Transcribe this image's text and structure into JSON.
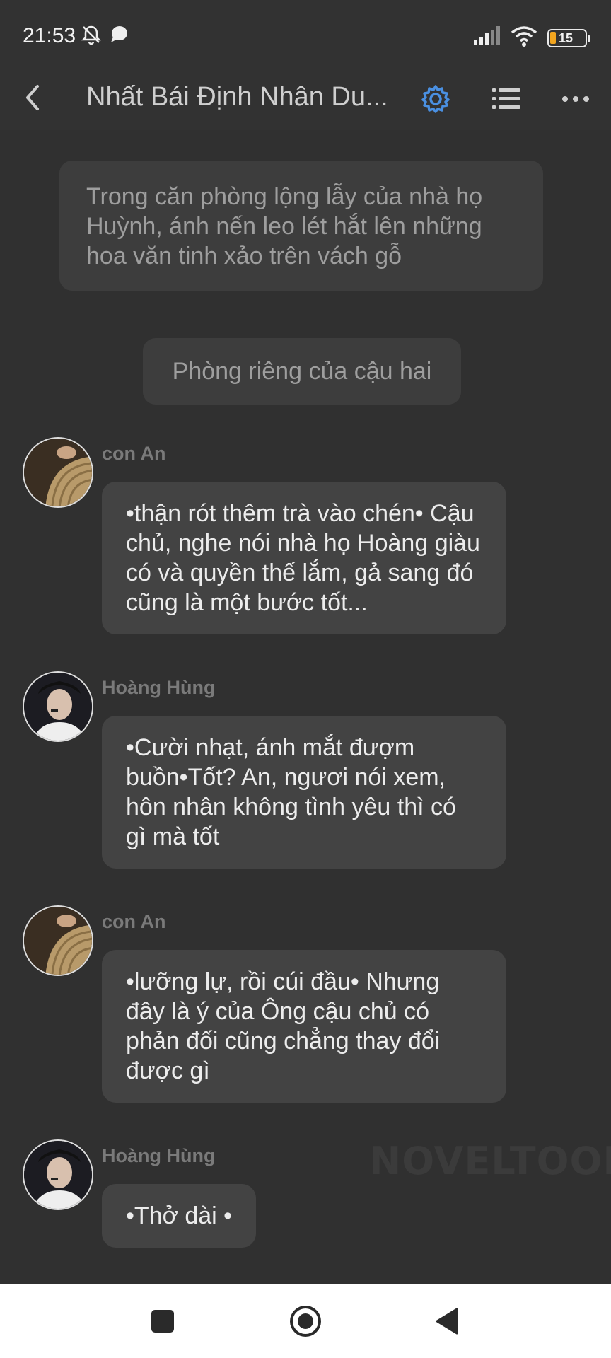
{
  "status": {
    "time": "21:53",
    "battery": "15"
  },
  "header": {
    "title": "Nhất Bái Định Nhân Du..."
  },
  "narration": "Trong căn phòng lộng lẫy của nhà họ Huỳnh, ánh nến leo lét hắt lên những hoa văn tinh xảo trên vách gỗ",
  "scene": "Phòng riêng của cậu hai",
  "messages": [
    {
      "sender": "con An",
      "text": "•thận rót thêm trà vào chén• Cậu chủ, nghe nói nhà họ Hoàng giàu có và quyền thế lắm, gả sang đó cũng là một bước tốt..."
    },
    {
      "sender": "Hoàng Hùng",
      "text": "•Cười nhạt, ánh mắt đượm buồn•Tốt? An, ngươi nói xem, hôn nhân không tình yêu thì có gì mà tốt"
    },
    {
      "sender": "con An",
      "text": "•lưỡng lự, rồi cúi đầu• Nhưng đây là ý của Ông cậu chủ có phản đối cũng chẳng thay đổi được gì"
    },
    {
      "sender": "Hoàng Hùng",
      "text": "•Thở dài •"
    }
  ],
  "watermark": "NOVELTOON",
  "colors": {
    "accent": "#4a90e2",
    "background": "#303030",
    "bubble": "#434343"
  }
}
